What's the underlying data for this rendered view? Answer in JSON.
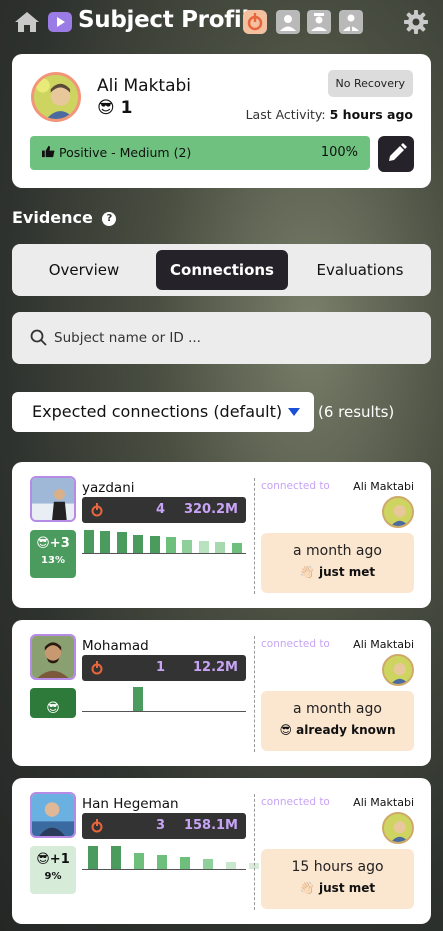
{
  "header": {
    "title": "Subject Profile",
    "icons": [
      "home-icon",
      "video-icon",
      "brightid-icon",
      "user-icon",
      "doctor-icon",
      "lawyer-icon",
      "gear-icon"
    ]
  },
  "profile": {
    "name": "Ali Maktabi",
    "score_emoji": "😎",
    "score": "1",
    "recovery_badge": "No Recovery",
    "last_activity_label": "Last Activity:",
    "last_activity_value": "5 hours ago",
    "rating_label": "Positive - Medium (2)",
    "rating_percent": "100%",
    "rating_fraction": 1.0
  },
  "evidence": {
    "title": "Evidence",
    "help": "?",
    "tabs": [
      {
        "label": "Overview",
        "active": false
      },
      {
        "label": "Connections",
        "active": true
      },
      {
        "label": "Evaluations",
        "active": false
      }
    ],
    "search_placeholder": "Subject name or ID ...",
    "filter_label": "Expected connections (default)",
    "results": "(6 results)"
  },
  "connections": [
    {
      "name": "yazdani",
      "count": "4",
      "value": "320.2M",
      "badge_emoji": "😎",
      "badge_score": "+3",
      "badge_percent": "13%",
      "badge_color": "#4c9b5e",
      "bars": [
        0.95,
        0.92,
        0.88,
        0.75,
        0.72,
        0.65,
        0.55,
        0.48,
        0.45,
        0.4
      ],
      "bar_colors": [
        "#4c9b5e",
        "#4c9b5e",
        "#4c9b5e",
        "#4c9b5e",
        "#4c9b5e",
        "#6fbf7c",
        "#8fd09a",
        "#b9e2bf",
        "#a8d8b0",
        "#6fbf7c"
      ],
      "connected_to_label": "connected to",
      "connected_to": "Ali Maktabi",
      "when": "a month ago",
      "relation_emoji": "👋🏻",
      "relation": "just met"
    },
    {
      "name": "Mohamad",
      "count": "1",
      "value": "12.2M",
      "badge_emoji": "😎",
      "badge_score": "",
      "badge_percent": "",
      "badge_color": "#2d7a3a",
      "bars": [
        0,
        0,
        0,
        1.0,
        0,
        0,
        0,
        0,
        0,
        0
      ],
      "bar_colors": [
        "#4c9b5e",
        "#4c9b5e",
        "#4c9b5e",
        "#4c9b5e",
        "#4c9b5e",
        "#4c9b5e",
        "#4c9b5e",
        "#4c9b5e",
        "#4c9b5e",
        "#4c9b5e"
      ],
      "connected_to_label": "connected to",
      "connected_to": "Ali Maktabi",
      "when": "a month ago",
      "relation_emoji": "😎",
      "relation": "already known"
    },
    {
      "name": "Han Hegeman",
      "count": "3",
      "value": "158.1M",
      "badge_emoji": "😎",
      "badge_score": "+1",
      "badge_percent": "9%",
      "badge_color": "#d6ecd9",
      "bars": [
        0.95,
        0.95,
        0.65,
        0.6,
        0.5,
        0.4,
        0.3,
        0.25
      ],
      "bar_colors": [
        "#4c9b5e",
        "#4c9b5e",
        "#6fbf7c",
        "#6fbf7c",
        "#6fbf7c",
        "#8fd09a",
        "#c8e8cd",
        "#d6ecd9"
      ],
      "connected_to_label": "connected to",
      "connected_to": "Ali Maktabi",
      "when": "15 hours ago",
      "relation_emoji": "👋🏻",
      "relation": "just met"
    }
  ]
}
